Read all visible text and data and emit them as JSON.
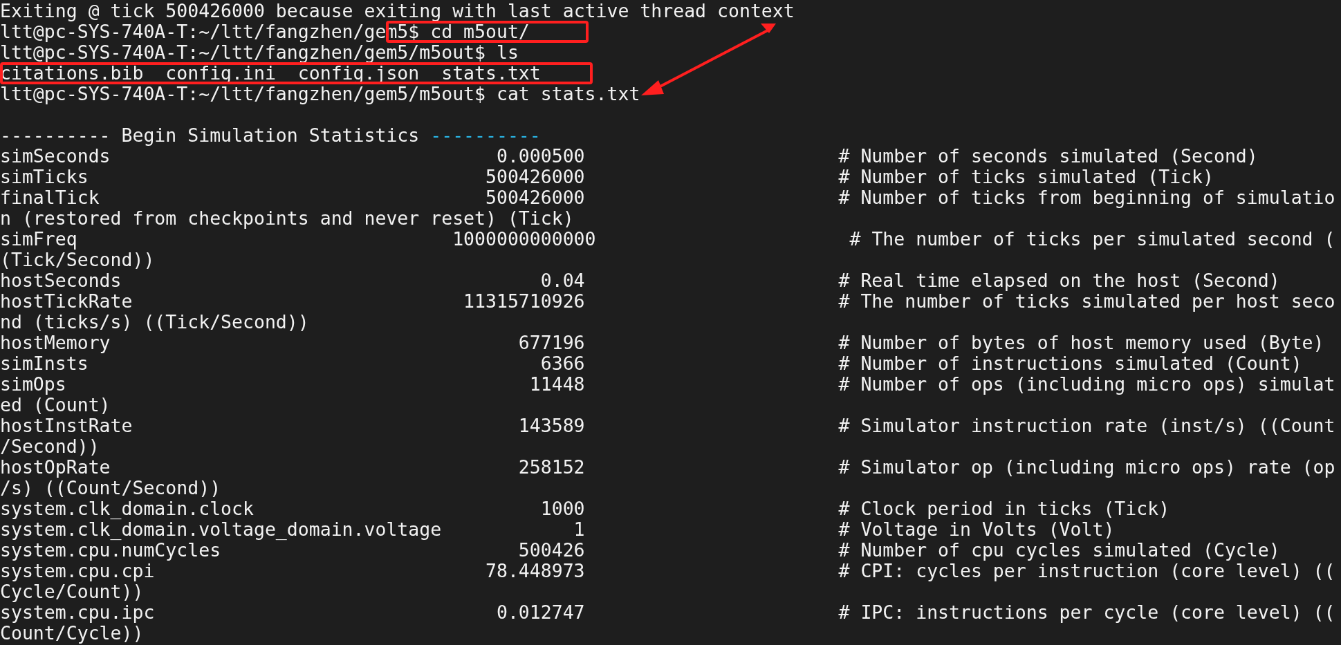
{
  "lines": [
    {
      "kind": "output",
      "text": "Exiting @ tick 500426000 because exiting with last active thread context"
    },
    {
      "kind": "prompt",
      "prompt": "ltt@pc-SYS-740A-T:~/ltt/fangzhen/gem5$",
      "command": "cd m5out/"
    },
    {
      "kind": "prompt",
      "prompt": "ltt@pc-SYS-740A-T:~/ltt/fangzhen/gem5/m5out$",
      "command": "ls"
    },
    {
      "kind": "files",
      "files": [
        "citations.bib",
        "config.ini",
        "config.json",
        "stats.txt"
      ]
    },
    {
      "kind": "prompt",
      "prompt": "ltt@pc-SYS-740A-T:~/ltt/fangzhen/gem5/m5out$",
      "command": "cat stats.txt"
    },
    {
      "kind": "blank"
    },
    {
      "kind": "header",
      "text": "---------- Begin Simulation Statistics",
      "trail": "----------"
    },
    {
      "kind": "stat",
      "name": "simSeconds",
      "value": "0.000500",
      "comment": "# Number of seconds simulated (Second)"
    },
    {
      "kind": "stat",
      "name": "simTicks",
      "value": "500426000",
      "comment": "# Number of ticks simulated (Tick)"
    },
    {
      "kind": "stat",
      "name": "finalTick",
      "value": "500426000",
      "comment": "# Number of ticks from beginning of simulatio"
    },
    {
      "kind": "output",
      "text": "n (restored from checkpoints and never reset) (Tick)"
    },
    {
      "kind": "stat",
      "name": "simFreq",
      "value": "1000000000000",
      "comment": "# The number of ticks per simulated second ("
    },
    {
      "kind": "output",
      "text": "(Tick/Second))"
    },
    {
      "kind": "stat",
      "name": "hostSeconds",
      "value": "0.04",
      "comment": "# Real time elapsed on the host (Second)"
    },
    {
      "kind": "stat",
      "name": "hostTickRate",
      "value": "11315710926",
      "comment": "# The number of ticks simulated per host seco"
    },
    {
      "kind": "output",
      "text": "nd (ticks/s) ((Tick/Second))"
    },
    {
      "kind": "stat",
      "name": "hostMemory",
      "value": "677196",
      "comment": "# Number of bytes of host memory used (Byte)"
    },
    {
      "kind": "stat",
      "name": "simInsts",
      "value": "6366",
      "comment": "# Number of instructions simulated (Count)"
    },
    {
      "kind": "stat",
      "name": "simOps",
      "value": "11448",
      "comment": "# Number of ops (including micro ops) simulat"
    },
    {
      "kind": "output",
      "text": "ed (Count)"
    },
    {
      "kind": "stat",
      "name": "hostInstRate",
      "value": "143589",
      "comment": "# Simulator instruction rate (inst/s) ((Count"
    },
    {
      "kind": "output",
      "text": "/Second))"
    },
    {
      "kind": "stat",
      "name": "hostOpRate",
      "value": "258152",
      "comment": "# Simulator op (including micro ops) rate (op"
    },
    {
      "kind": "output",
      "text": "/s) ((Count/Second))"
    },
    {
      "kind": "stat",
      "name": "system.clk_domain.clock",
      "value": "1000",
      "comment": "# Clock period in ticks (Tick)"
    },
    {
      "kind": "stat",
      "name": "system.clk_domain.voltage_domain.voltage",
      "value": "1",
      "comment": "# Voltage in Volts (Volt)"
    },
    {
      "kind": "stat",
      "name": "system.cpu.numCycles",
      "value": "500426",
      "comment": "# Number of cpu cycles simulated (Cycle)"
    },
    {
      "kind": "stat",
      "name": "system.cpu.cpi",
      "value": "78.448973",
      "comment": "# CPI: cycles per instruction (core level) (("
    },
    {
      "kind": "output",
      "text": "Cycle/Count))"
    },
    {
      "kind": "stat",
      "name": "system.cpu.ipc",
      "value": "0.012747",
      "comment": "# IPC: instructions per cycle (core level) (("
    },
    {
      "kind": "output",
      "text": "Count/Cycle))"
    }
  ]
}
